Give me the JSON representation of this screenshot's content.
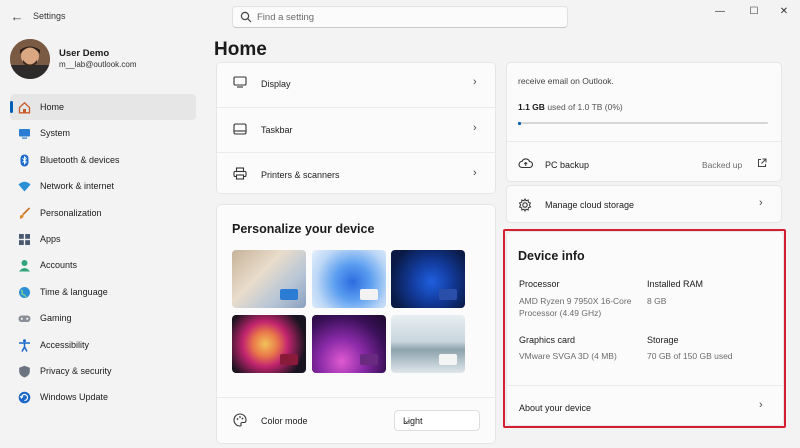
{
  "window": {
    "title": "Settings",
    "minimize": "—",
    "maximize": "☐",
    "close": "✕"
  },
  "search": {
    "placeholder": "Find a setting"
  },
  "user": {
    "name": "User Demo",
    "email": "m__lab@outlook.com"
  },
  "sidebar": {
    "items": [
      {
        "label": "Home",
        "icon": "home-icon"
      },
      {
        "label": "System",
        "icon": "monitor-icon"
      },
      {
        "label": "Bluetooth & devices",
        "icon": "bluetooth-icon"
      },
      {
        "label": "Network & internet",
        "icon": "wifi-icon"
      },
      {
        "label": "Personalization",
        "icon": "brush-icon"
      },
      {
        "label": "Apps",
        "icon": "apps-icon"
      },
      {
        "label": "Accounts",
        "icon": "person-icon"
      },
      {
        "label": "Time & language",
        "icon": "globe-icon"
      },
      {
        "label": "Gaming",
        "icon": "gamepad-icon"
      },
      {
        "label": "Accessibility",
        "icon": "accessibility-icon"
      },
      {
        "label": "Privacy & security",
        "icon": "shield-icon"
      },
      {
        "label": "Windows Update",
        "icon": "update-icon"
      }
    ]
  },
  "main": {
    "title": "Home",
    "devices": {
      "display": "Display",
      "taskbar": "Taskbar",
      "printers": "Printers & scanners"
    },
    "personalize": {
      "title": "Personalize your device",
      "color_mode_label": "Color mode",
      "color_mode_value": "Light"
    },
    "cloud": {
      "email_text": "receive email on Outlook.",
      "used_amount": "1.1 GB",
      "used_rest": "used of 1.0 TB (0%)",
      "usage_fraction": 0.01,
      "pc_backup": "PC backup",
      "backed_up": "Backed up",
      "manage": "Manage cloud storage"
    },
    "device_info": {
      "title": "Device info",
      "processor_label": "Processor",
      "processor_value": "AMD Ryzen 9 7950X 16-Core Processor (4.49 GHz)",
      "ram_label": "Installed RAM",
      "ram_value": "8 GB",
      "graphics_label": "Graphics card",
      "graphics_value": "VMware SVGA 3D (4 MB)",
      "storage_label": "Storage",
      "storage_value": "70 GB of 150 GB used",
      "about": "About your device"
    }
  },
  "colors": {
    "accent": "#005fb8",
    "highlight_border": "#d31f2f"
  }
}
